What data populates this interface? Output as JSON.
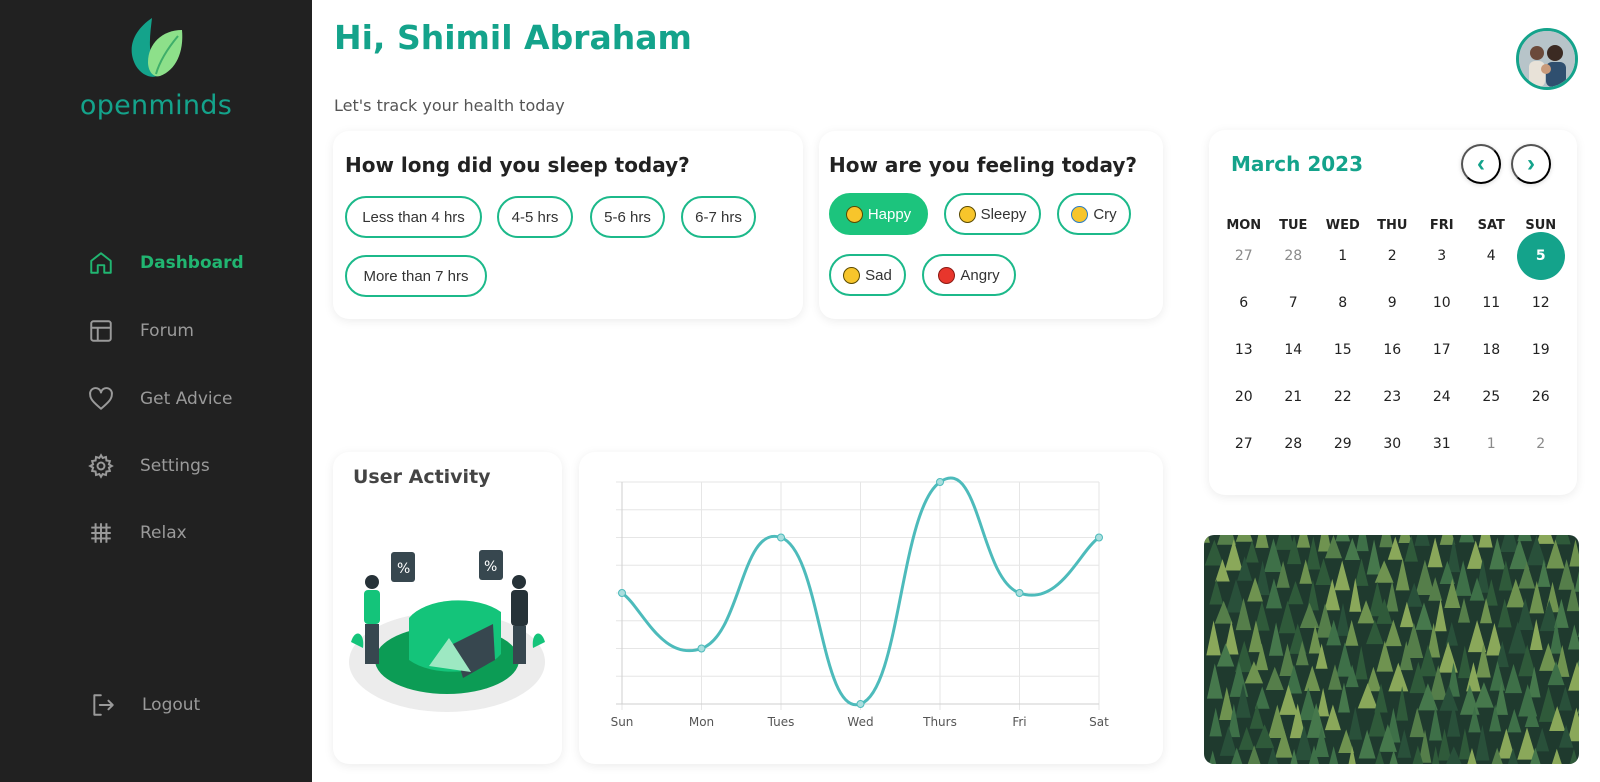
{
  "app": {
    "name": "openminds"
  },
  "sidebar": {
    "items": [
      {
        "label": "Dashboard",
        "icon": "home-icon",
        "active": true
      },
      {
        "label": "Forum",
        "icon": "layout-icon",
        "active": false
      },
      {
        "label": "Get Advice",
        "icon": "heart-icon",
        "active": false
      },
      {
        "label": "Settings",
        "icon": "gear-icon",
        "active": false
      },
      {
        "label": "Relax",
        "icon": "relax-icon",
        "active": false
      }
    ],
    "logout": {
      "label": "Logout",
      "icon": "logout-icon"
    }
  },
  "header": {
    "greeting": "Hi, Shimil Abraham",
    "subtitle": "Let's track your health today"
  },
  "sleep": {
    "question": "How long did you sleep today?",
    "options": [
      "Less than 4 hrs",
      "4-5 hrs",
      "5-6 hrs",
      "6-7 hrs",
      "More than 7 hrs"
    ]
  },
  "mood": {
    "question": "How are you feeling today?",
    "options": [
      {
        "label": "Happy",
        "icon": "happy-emoji-icon",
        "selected": true
      },
      {
        "label": "Sleepy",
        "icon": "sleepy-emoji-icon",
        "selected": false
      },
      {
        "label": "Cry",
        "icon": "cry-emoji-icon",
        "selected": false
      },
      {
        "label": "Sad",
        "icon": "sad-emoji-icon",
        "selected": false
      },
      {
        "label": "Angry",
        "icon": "angry-emoji-icon",
        "selected": false
      }
    ]
  },
  "calendar": {
    "title": "March 2023",
    "prev": "‹",
    "next": "›",
    "weekdays": [
      "MON",
      "TUE",
      "WED",
      "THU",
      "FRI",
      "SAT",
      "SUN"
    ],
    "weeks": [
      [
        "27",
        "28",
        "1",
        "2",
        "3",
        "4",
        "5"
      ],
      [
        "6",
        "7",
        "8",
        "9",
        "10",
        "11",
        "12"
      ],
      [
        "13",
        "14",
        "15",
        "16",
        "17",
        "18",
        "19"
      ],
      [
        "20",
        "21",
        "22",
        "23",
        "24",
        "25",
        "26"
      ],
      [
        "27",
        "28",
        "29",
        "30",
        "31",
        "1",
        "2"
      ]
    ],
    "today": "5"
  },
  "activity": {
    "title": "User Activity"
  },
  "chart_data": {
    "type": "line",
    "categories": [
      "Sun",
      "Mon",
      "Tues",
      "Wed",
      "Thurs",
      "Fri",
      "Sat"
    ],
    "series": [
      {
        "values": [
          4,
          2,
          6,
          0,
          8,
          4,
          6
        ]
      }
    ],
    "ylim": [
      0,
      8
    ],
    "grid": true,
    "color": "#4dbbbb"
  },
  "colors": {
    "accent": "#14a38b",
    "green": "#1cc47d",
    "sidebar": "#212121"
  }
}
